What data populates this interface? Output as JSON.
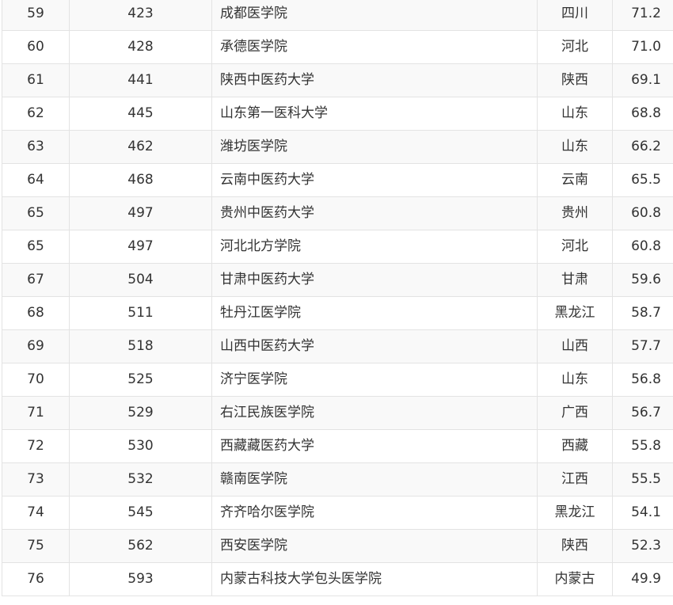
{
  "table": {
    "rows": [
      {
        "rank": "59",
        "world": "423",
        "name": "成都医学院",
        "province": "四川",
        "score": "71.2"
      },
      {
        "rank": "60",
        "world": "428",
        "name": "承德医学院",
        "province": "河北",
        "score": "71.0"
      },
      {
        "rank": "61",
        "world": "441",
        "name": "陕西中医药大学",
        "province": "陕西",
        "score": "69.1"
      },
      {
        "rank": "62",
        "world": "445",
        "name": "山东第一医科大学",
        "province": "山东",
        "score": "68.8"
      },
      {
        "rank": "63",
        "world": "462",
        "name": "潍坊医学院",
        "province": "山东",
        "score": "66.2"
      },
      {
        "rank": "64",
        "world": "468",
        "name": "云南中医药大学",
        "province": "云南",
        "score": "65.5"
      },
      {
        "rank": "65",
        "world": "497",
        "name": "贵州中医药大学",
        "province": "贵州",
        "score": "60.8"
      },
      {
        "rank": "65",
        "world": "497",
        "name": "河北北方学院",
        "province": "河北",
        "score": "60.8"
      },
      {
        "rank": "67",
        "world": "504",
        "name": "甘肃中医药大学",
        "province": "甘肃",
        "score": "59.6"
      },
      {
        "rank": "68",
        "world": "511",
        "name": "牡丹江医学院",
        "province": "黑龙江",
        "score": "58.7"
      },
      {
        "rank": "69",
        "world": "518",
        "name": "山西中医药大学",
        "province": "山西",
        "score": "57.7"
      },
      {
        "rank": "70",
        "world": "525",
        "name": "济宁医学院",
        "province": "山东",
        "score": "56.8"
      },
      {
        "rank": "71",
        "world": "529",
        "name": "右江民族医学院",
        "province": "广西",
        "score": "56.7"
      },
      {
        "rank": "72",
        "world": "530",
        "name": "西藏藏医药大学",
        "province": "西藏",
        "score": "55.8"
      },
      {
        "rank": "73",
        "world": "532",
        "name": "赣南医学院",
        "province": "江西",
        "score": "55.5"
      },
      {
        "rank": "74",
        "world": "545",
        "name": "齐齐哈尔医学院",
        "province": "黑龙江",
        "score": "54.1"
      },
      {
        "rank": "75",
        "world": "562",
        "name": "西安医学院",
        "province": "陕西",
        "score": "52.3"
      },
      {
        "rank": "76",
        "world": "593",
        "name": "内蒙古科技大学包头医学院",
        "province": "内蒙古",
        "score": "49.9"
      }
    ]
  }
}
